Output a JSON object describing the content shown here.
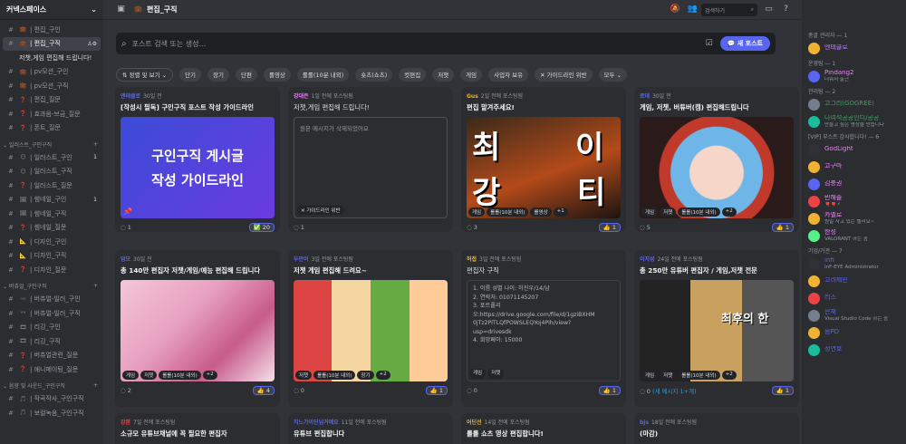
{
  "server": {
    "name": "커넥스페이스"
  },
  "channels": [
    {
      "type": "ch",
      "icon": "#",
      "emoji": "💼",
      "name": "편집_구인"
    },
    {
      "type": "ch",
      "icon": "#",
      "emoji": "💼",
      "name": "편집_구직",
      "active": true
    },
    {
      "type": "thread",
      "name": "저챗,게임 편집해 드립니다!"
    },
    {
      "type": "ch",
      "icon": "#",
      "emoji": "💼",
      "name": "pv모션_구인"
    },
    {
      "type": "ch",
      "icon": "#",
      "emoji": "💼",
      "name": "pv모션_구직"
    },
    {
      "type": "ch",
      "icon": "#",
      "emoji": "❓",
      "name": "편집_질문"
    },
    {
      "type": "ch",
      "icon": "#",
      "emoji": "❓",
      "name": "효과음-브금_질문"
    },
    {
      "type": "ch",
      "icon": "#",
      "emoji": "❓",
      "name": "폰트_질문"
    },
    {
      "type": "cat",
      "name": "일러스트_구인구직"
    },
    {
      "type": "ch",
      "icon": "#",
      "emoji": "😶",
      "name": "일러스트_구인",
      "badge": "1"
    },
    {
      "type": "ch",
      "icon": "#",
      "emoji": "😶",
      "name": "일러스트_구직"
    },
    {
      "type": "ch",
      "icon": "#",
      "emoji": "❓",
      "name": "일러스트_질문"
    },
    {
      "type": "ch",
      "icon": "#",
      "emoji": "🖼",
      "name": "썸네일_구인",
      "badge": "1"
    },
    {
      "type": "ch",
      "icon": "#",
      "emoji": "🖼",
      "name": "썸네일_구직"
    },
    {
      "type": "ch",
      "icon": "#",
      "emoji": "❓",
      "name": "썸네일_질문"
    },
    {
      "type": "ch",
      "icon": "#",
      "emoji": "📐",
      "name": "디자인_구인"
    },
    {
      "type": "ch",
      "icon": "#",
      "emoji": "📐",
      "name": "디자인_구직"
    },
    {
      "type": "ch",
      "icon": "#",
      "emoji": "❓",
      "name": "디자인_질문"
    },
    {
      "type": "cat",
      "name": "버츄얼_구인구직"
    },
    {
      "type": "ch",
      "icon": "#",
      "emoji": "〰",
      "name": "버츄얼-일러_구인"
    },
    {
      "type": "ch",
      "icon": "#",
      "emoji": "〰",
      "name": "버츄얼-일러_구직"
    },
    {
      "type": "ch",
      "icon": "#",
      "emoji": "🎞",
      "name": "리깅_구인"
    },
    {
      "type": "ch",
      "icon": "#",
      "emoji": "🎞",
      "name": "리깅_구직"
    },
    {
      "type": "ch",
      "icon": "#",
      "emoji": "❓",
      "name": "버츄얼관련_질문"
    },
    {
      "type": "ch",
      "icon": "#",
      "emoji": "❓",
      "name": "애니메이팅_질문"
    },
    {
      "type": "cat",
      "name": "음향 및 사운드_구인구직"
    },
    {
      "type": "ch",
      "icon": "#",
      "emoji": "🎵",
      "name": "작곡작사_구인구직"
    },
    {
      "type": "ch",
      "icon": "#",
      "emoji": "🎵",
      "name": "보컬녹음_구인구직"
    }
  ],
  "topbar": {
    "title": "편집_구직",
    "search_placeholder": "검색하기"
  },
  "forum": {
    "search_placeholder": "포스트 검색 또는 생성...",
    "new_post": "새 포스트"
  },
  "filters": {
    "sort": "정렬 및 보기",
    "chips": [
      "단기",
      "장기",
      "단편",
      "롤영상",
      "롤롤(10분 내외)",
      "숏츠(쇼츠)",
      "컷편집",
      "저챗",
      "게임",
      "사업자 보유",
      "가이드라인 위반"
    ],
    "all": "모두"
  },
  "posts": [
    {
      "author": "엔테클로",
      "author_color": "#5865f2",
      "time": "30일 전",
      "title": "[작성시 필독] 구인구직 포스트 작성 가이드라인",
      "thumb": "guide",
      "thumb_text": [
        "구인구직 게시글",
        "작성 가이드라인"
      ],
      "tags": [],
      "left": "1",
      "right": "20",
      "emoji": "✅"
    },
    {
      "author": "강대은",
      "author_color": "#f47fff",
      "time": "1일 전에 포스팅됨",
      "title": "저챗,게임 편집해 드립니다!",
      "desc": "원본 메시지가 삭제되었어요",
      "violation": "가이드라인 위반",
      "tags": [],
      "left": "1",
      "right": ""
    },
    {
      "author": "Gus",
      "author_color": "#f0b232",
      "time": "2일 전에 포스팅됨",
      "title": "편집 맡겨주세요!",
      "thumb": "game",
      "thumb_text": [
        "최",
        "이",
        "강",
        "티"
      ],
      "tags": [
        "게임",
        "롤롤(10분 내외)",
        "롤영상",
        "+1"
      ],
      "left": "3",
      "right": "1",
      "emoji": "👍"
    },
    {
      "author": "로데",
      "author_color": "#5865f2",
      "time": "30일 전",
      "title": "게임, 저챗, 버튜버(캠) 편집해드립니다",
      "thumb": "anime",
      "tags": [
        "게임",
        "저챗",
        "롤롤(10분 내외)",
        "+2"
      ],
      "left": "5",
      "right": "1",
      "emoji": "👍"
    },
    {
      "author": "덩모",
      "author_color": "#5865f2",
      "time": "30일 전",
      "title": "총 140만 편집자 저챗/게임/예능 편집해 드립니다",
      "thumb": "manga",
      "tags": [
        "게임",
        "저챗",
        "롤롤(10분 내외)",
        "+2"
      ],
      "left": "2",
      "right": "4",
      "emoji": "👍"
    },
    {
      "author": "두만이",
      "author_color": "#5865f2",
      "time": "3일 전에 포스팅됨",
      "title": "저챗 게임 편집해 드려요~",
      "thumb": "comic",
      "tags": [
        "저챗",
        "롤롤(10분 내외)",
        "장기",
        "+2"
      ],
      "left": "0",
      "right": "1",
      "emoji": "👍"
    },
    {
      "author": "허접",
      "author_color": "#f0b232",
      "time": "3일 전에 포스팅됨",
      "title": "편집자 구직",
      "lines": [
        "1. 이름 성별 나이: 허진우/14/남",
        "2. 연락처: 01071145207",
        "3. 포트폴리",
        "오:https://drive.google.com/file/d/1gziBXHM",
        "0jTz2PiTLQfPOWSLEQYoj4Pih/view?",
        "usp=drivesdk",
        "4. 희망페이: 15000"
      ],
      "tags": [
        "게임",
        "저챗"
      ],
      "left": "0",
      "right": "1",
      "emoji": "👍"
    },
    {
      "author": "이지성",
      "author_color": "#5865f2",
      "time": "24일 전에 포스팅됨",
      "title": "총 250만 유튜버 편집자 / 게임,저챗 전문",
      "thumb": "collage",
      "thumb_text": [
        "최후의 한"
      ],
      "tags": [
        "게임",
        "저챗",
        "롤롤(10분 내외)",
        "+2"
      ],
      "left": "0",
      "leftnote": "(새 메시지 1+개)",
      "right": "1",
      "emoji": "👍"
    },
    {
      "author": "강환",
      "author_color": "#f23f43",
      "time": "7일 전에 포스팅됨",
      "title": "소규모 유튜브채널에 꼭 필요한 편집자",
      "tags": [],
      "left": "",
      "right": ""
    },
    {
      "author": "치느가이딘넘거예요",
      "author_color": "#5865f2",
      "time": "11일 전에 포스팅됨",
      "title": "유튜브 편집합니다",
      "tags": [],
      "left": "",
      "right": ""
    },
    {
      "author": "어딘선",
      "author_color": "#f0b232",
      "time": "14일 전에 포스팅됨",
      "title": "롤롤 쇼츠 영상 편집합니다!",
      "tags": [],
      "left": "",
      "right": ""
    },
    {
      "author": "bjs",
      "author_color": "#5865f2",
      "time": "18일 전에 포스팅됨",
      "title": "(마감)",
      "tags": [],
      "left": "",
      "right": ""
    }
  ],
  "members": [
    {
      "cat": "총괄 관리자 — 1"
    },
    {
      "name": "엔테클로",
      "color": "#c27cff",
      "av": "#f0b232"
    },
    {
      "cat": "운영팀 — 1"
    },
    {
      "name": "Pindang2",
      "color": "#f47fff",
      "av": "#5865f2",
      "status": "더워서 출근"
    },
    {
      "cat": "관리팀 — 2"
    },
    {
      "name": "고그리(GOGREE)",
      "color": "#3ba55c",
      "av": "#747f8d"
    },
    {
      "name": "나여석공공인디/공공",
      "color": "#3ba55c",
      "av": "#1abc9c",
      "status": "만들고 싶은 영상을 만듭니다"
    },
    {
      "cat": "[VIP] 부스트 감사합니다! — 6"
    },
    {
      "name": "GodLight",
      "color": "#f47fff",
      "av": "#2f3136"
    },
    {
      "name": "고구마",
      "color": "#f47fff",
      "av": "#f0b232"
    },
    {
      "name": "김충권",
      "color": "#f47fff",
      "av": "#5865f2"
    },
    {
      "name": "빈해솔",
      "color": "#f47fff",
      "av": "#ed4245",
      "status": "🎈🎈⚡"
    },
    {
      "name": "카멜로",
      "color": "#f47fff",
      "av": "#f0b232",
      "status": "뭔일 사고 있는 빨리요~"
    },
    {
      "name": "한성",
      "color": "#f47fff",
      "av": "#57f287",
      "status": "VALORANT 하는 중"
    },
    {
      "cat": "기업/기관 — 7"
    },
    {
      "name": "infi",
      "color": "#5865f2",
      "av": "#2f3136",
      "status": "InF-EYE Administrator"
    },
    {
      "name": "고려제민",
      "color": "#5865f2",
      "av": "#f0b232"
    },
    {
      "name": "리스",
      "color": "#5865f2",
      "av": "#ed4245"
    },
    {
      "name": "은재",
      "color": "#5865f2",
      "av": "#747f8d",
      "status": "Visual Studio Code 하는 중"
    },
    {
      "name": "음PD",
      "color": "#5865f2",
      "av": "#f0b232"
    },
    {
      "name": "정연호",
      "color": "#5865f2",
      "av": "#1abc9c"
    }
  ]
}
